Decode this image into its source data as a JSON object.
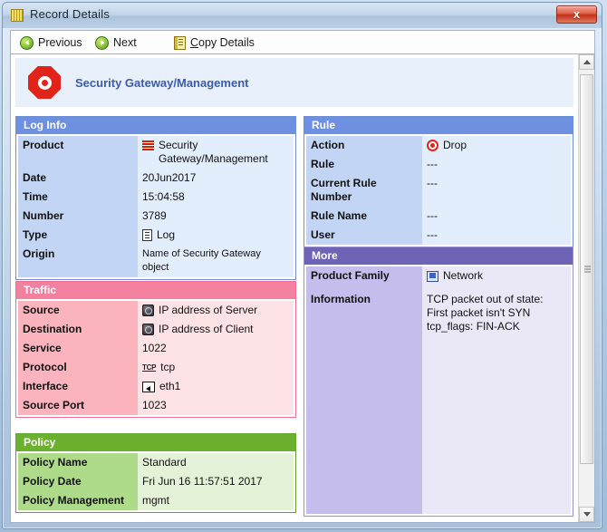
{
  "window": {
    "title": "Record Details",
    "title_icon": "grid-icon",
    "close_label": "x"
  },
  "toolbar": {
    "previous_label": "Previous",
    "next_label": "Next",
    "copy_label_first": "C",
    "copy_label_rest": "opy Details"
  },
  "banner": {
    "icon": "red-octagon-icon",
    "title": "Security Gateway/Management"
  },
  "colors": {
    "blue_header": "#6d91e0",
    "pink_header": "#f4809f",
    "green_header": "#6cb02f",
    "purple_header": "#6d64b5",
    "banner_title": "#3b5ba8",
    "close_button": "#c32f17"
  },
  "cards": {
    "log_info": {
      "header": "Log Info",
      "rows": [
        {
          "key": "Product",
          "value": "Security Gateway/Management",
          "icon": "brick-firewall-icon"
        },
        {
          "key": "Date",
          "value": "20Jun2017",
          "icon": null
        },
        {
          "key": "Time",
          "value": "15:04:58",
          "icon": null
        },
        {
          "key": "Number",
          "value": "3789",
          "icon": null
        },
        {
          "key": "Type",
          "value": "Log",
          "icon": "log-document-icon"
        },
        {
          "key": "Origin",
          "value": "Name of Security Gateway object",
          "icon": null
        }
      ]
    },
    "traffic": {
      "header": "Traffic",
      "rows": [
        {
          "key": "Source",
          "value": "IP address of Server",
          "icon": "globe-host-icon"
        },
        {
          "key": "Destination",
          "value": "IP address of Client",
          "icon": "globe-host-icon"
        },
        {
          "key": "Service",
          "value": "1022",
          "icon": null
        },
        {
          "key": "Protocol",
          "value": "tcp",
          "icon": "tcp-icon"
        },
        {
          "key": "Interface",
          "value": "eth1",
          "icon": "interface-inbound-icon"
        },
        {
          "key": "Source Port",
          "value": "1023",
          "icon": null
        }
      ]
    },
    "policy": {
      "header": "Policy",
      "rows": [
        {
          "key": "Policy Name",
          "value": "Standard",
          "icon": null
        },
        {
          "key": "Policy Date",
          "value": "Fri Jun 16 11:57:51 2017",
          "icon": null
        },
        {
          "key": "Policy Management",
          "value": "mgmt",
          "icon": null
        }
      ]
    },
    "rule": {
      "header": "Rule",
      "rows": [
        {
          "key": "Action",
          "value": "Drop",
          "icon": "drop-action-icon"
        },
        {
          "key": "Rule",
          "value": "---",
          "icon": null
        },
        {
          "key": "Current Rule Number",
          "value": "---",
          "icon": null
        },
        {
          "key": "Rule Name",
          "value": "---",
          "icon": null
        },
        {
          "key": "User",
          "value": "---",
          "icon": null
        }
      ]
    },
    "more": {
      "header": "More",
      "rows": [
        {
          "key": "Product Family",
          "value": "Network",
          "icon": "network-computer-icon"
        },
        {
          "key": "Information",
          "value": "TCP packet out of state: First packet isn't SYN\ntcp_flags: FIN-ACK",
          "icon": null
        }
      ]
    }
  },
  "scrollbar": {
    "up_icon": "triangle-up-icon",
    "down_icon": "triangle-down-icon"
  }
}
